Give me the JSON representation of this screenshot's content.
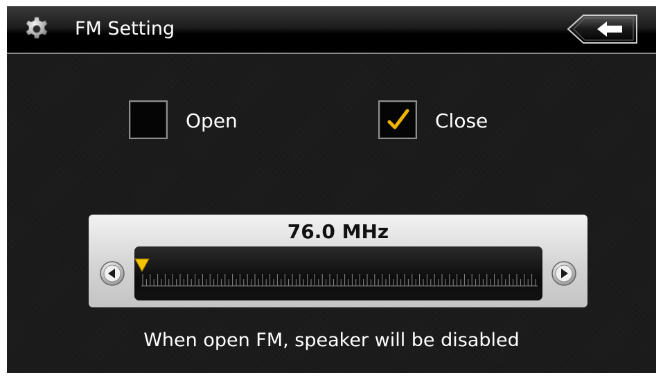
{
  "header": {
    "title": "FM Setting",
    "settings_icon": "gear-icon",
    "back_icon": "back-arrow-icon"
  },
  "options": [
    {
      "label": "Open",
      "checked": false
    },
    {
      "label": "Close",
      "checked": true
    }
  ],
  "tuner": {
    "frequency": "76.0 MHz",
    "position_fraction": 0.0,
    "prev_icon": "chevron-left-icon",
    "next_icon": "chevron-right-icon"
  },
  "note": "When open FM, speaker will be disabled",
  "colors": {
    "check": "#f0b400",
    "marker": "#f5c400",
    "panel": "#d8d8d8",
    "background": "#1b1b1b"
  }
}
